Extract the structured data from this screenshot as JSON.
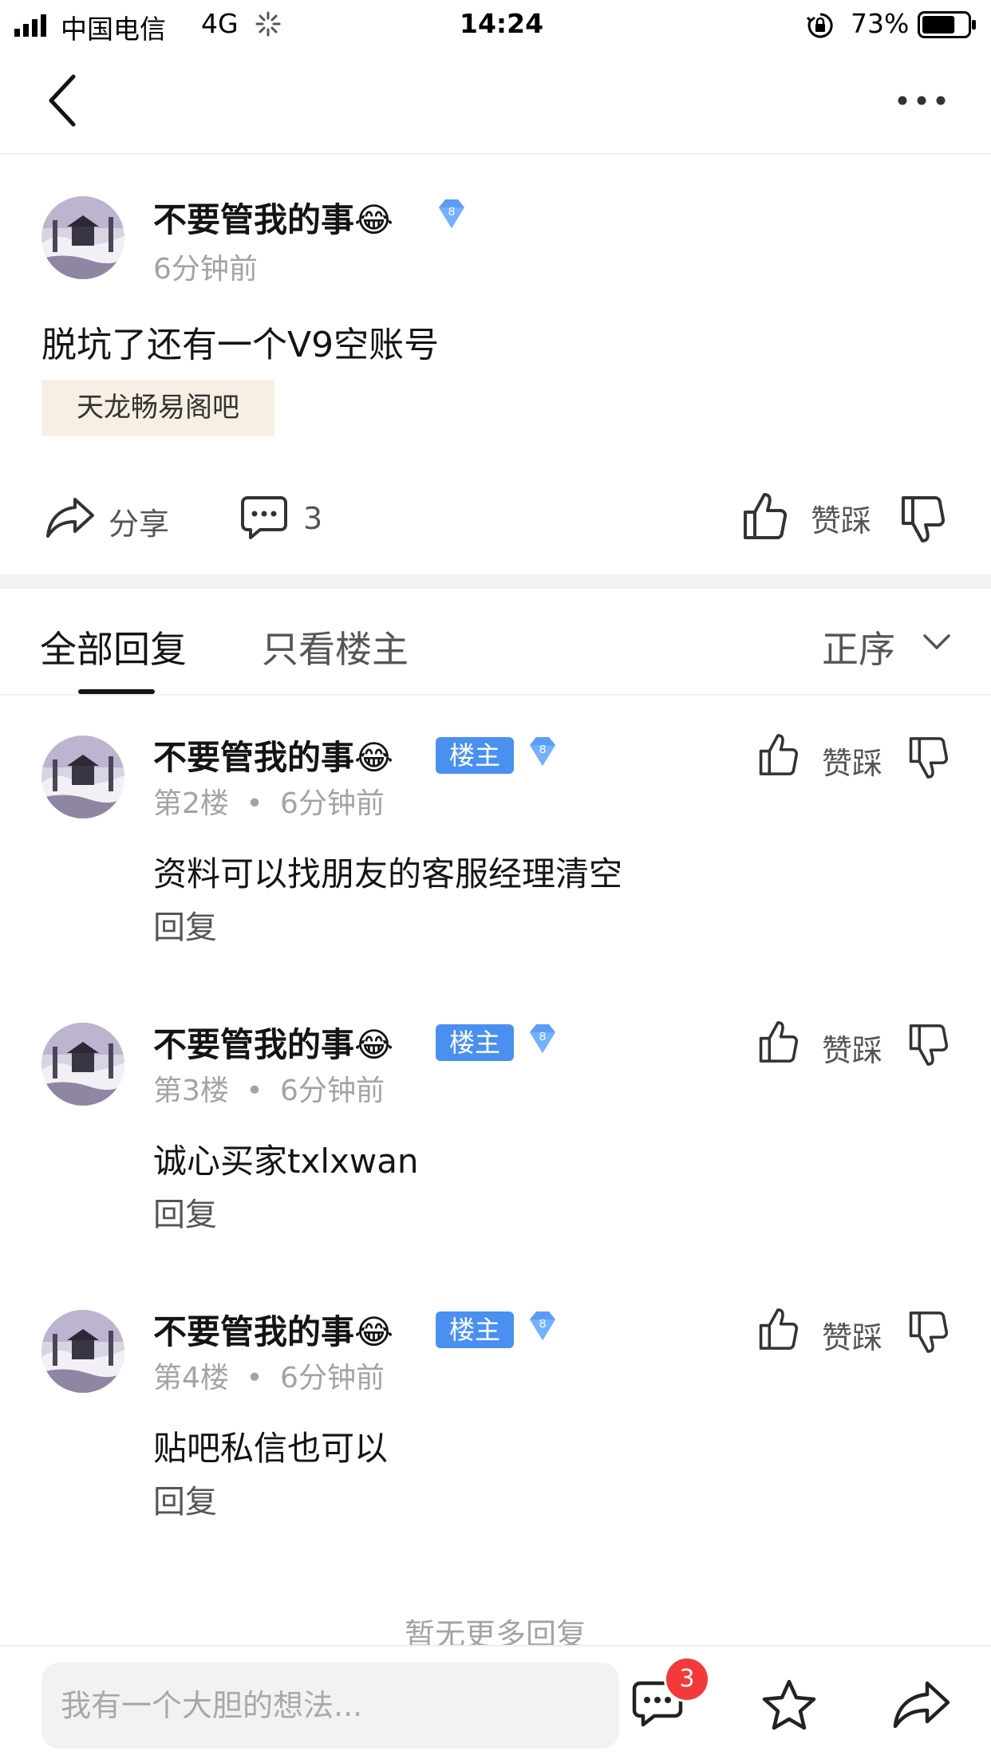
{
  "status_bar": {
    "carrier": "中国电信",
    "network": "4G",
    "time": "14:24",
    "battery": "73%",
    "battery_level": 0.73
  },
  "post": {
    "author": "不要管我的事😂",
    "level": "8",
    "time": "6分钟前",
    "content": "脱坑了还有一个V9空账号",
    "forum_tag": "天龙畅易阁吧",
    "share_label": "分享",
    "comment_count": "3",
    "vote_label": "赞踩"
  },
  "tabs": {
    "all": "全部回复",
    "owner_only": "只看楼主",
    "sort": "正序"
  },
  "replies": [
    {
      "author": "不要管我的事😂",
      "badge": "楼主",
      "level": "8",
      "floor": "第2楼",
      "time": "6分钟前",
      "content": "资料可以找朋友的客服经理清空",
      "reply_label": "回复",
      "vote_label": "赞踩"
    },
    {
      "author": "不要管我的事😂",
      "badge": "楼主",
      "level": "8",
      "floor": "第3楼",
      "time": "6分钟前",
      "content": "诚心买家txlxwan",
      "reply_label": "回复",
      "vote_label": "赞踩"
    },
    {
      "author": "不要管我的事😂",
      "badge": "楼主",
      "level": "8",
      "floor": "第4楼",
      "time": "6分钟前",
      "content": "贴吧私信也可以",
      "reply_label": "回复",
      "vote_label": "赞踩"
    }
  ],
  "footer_note": "暂无更多回复",
  "bottom_bar": {
    "input_placeholder": "我有一个大胆的想法...",
    "message_badge": "3"
  },
  "colors": {
    "owner_badge": "#4a90f0",
    "tag_bg": "#f8efe4",
    "red_badge": "#f23a3a"
  }
}
